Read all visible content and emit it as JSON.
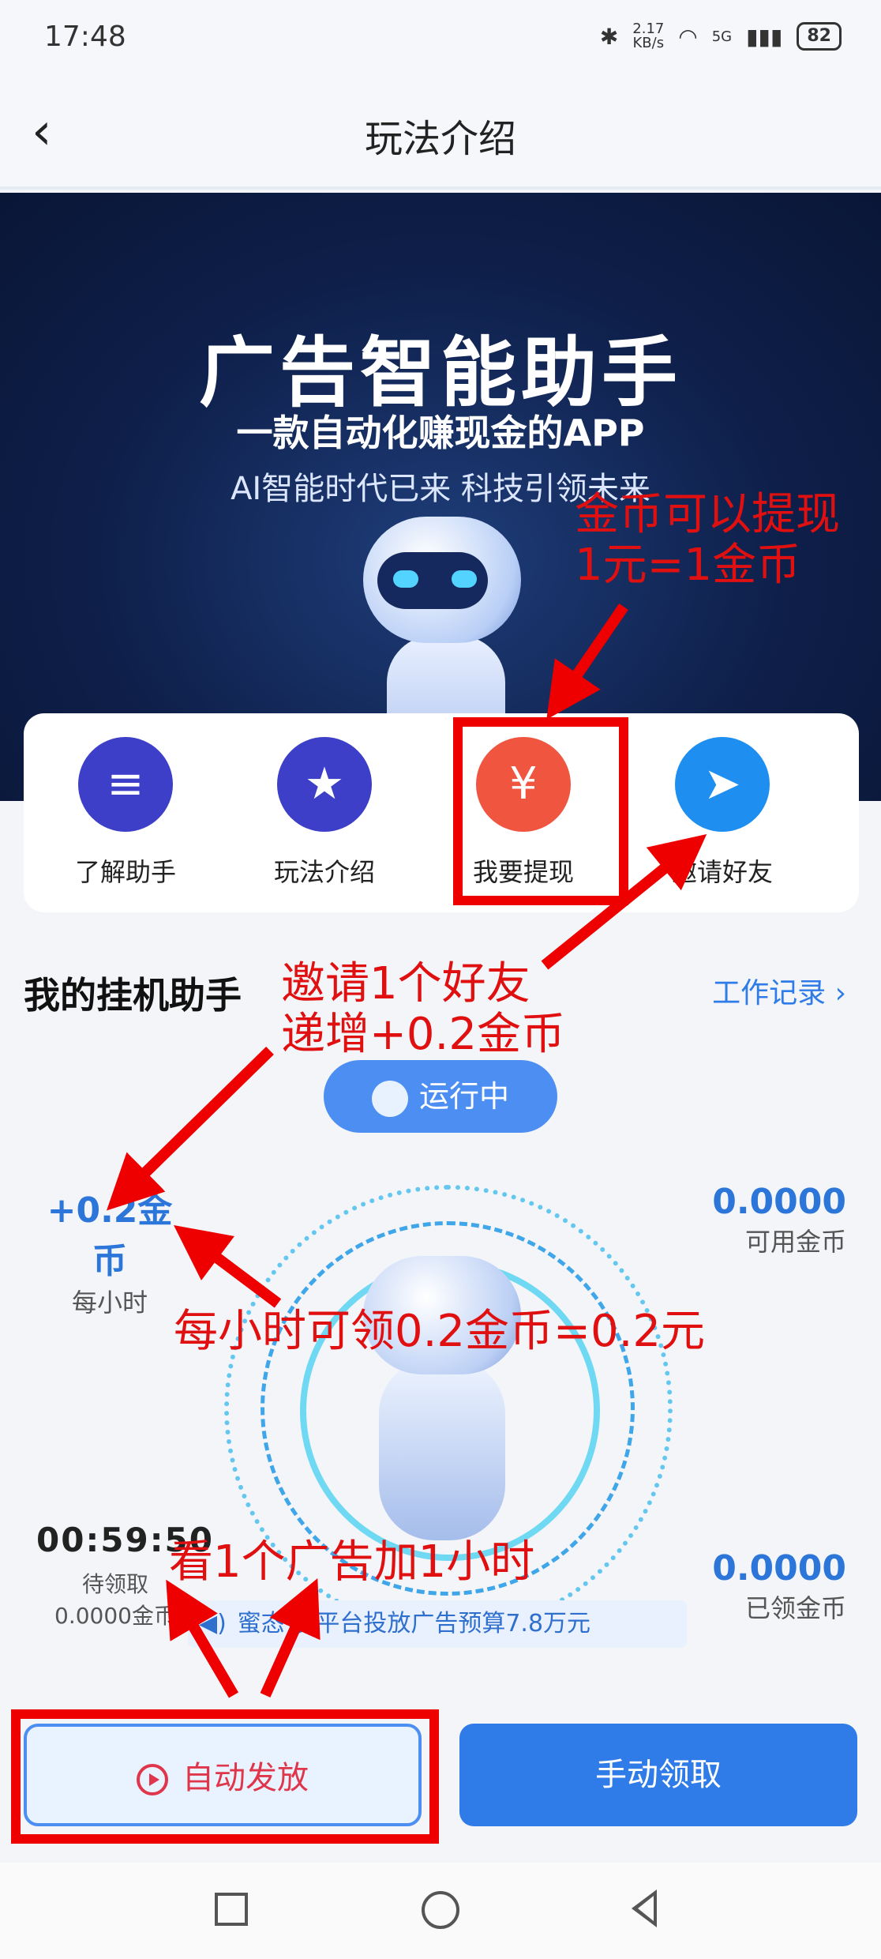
{
  "status": {
    "time": "17:48",
    "speed": "2.17 KB/s",
    "network": "5G",
    "battery": "82"
  },
  "header": {
    "title": "玩法介绍"
  },
  "banner": {
    "title": "广告智能助手",
    "subtitle": "一款自动化赚现金的APP",
    "tagline": "AI智能时代已来 科技引领未来"
  },
  "menu": {
    "items": [
      {
        "label": "了解助手",
        "color": "#3d3fc8"
      },
      {
        "label": "玩法介绍",
        "color": "#3d3fc8"
      },
      {
        "label": "我要提现",
        "color": "#f0553f"
      },
      {
        "label": "邀请好友",
        "color": "#1e8ff0"
      }
    ]
  },
  "section": {
    "title": "我的挂机助手",
    "record": "工作记录"
  },
  "running": "运行中",
  "stats": {
    "rate": "+0.2金币",
    "rate_unit": "每小时",
    "available": "0.0000",
    "available_label": "可用金币",
    "timer": "00:59:50",
    "pending_label": "待领取",
    "pending_value": "0.0000金币",
    "claimed": "0.0000",
    "claimed_label": "已领金币"
  },
  "ticker": "蜜态 友平台投放广告预算7.8万元",
  "buttons": {
    "auto": "自动发放",
    "manual": "手动领取"
  },
  "annotations": {
    "a1_line1": "金币可以提现",
    "a1_line2": "1元=1金币",
    "a2_line1": "邀请1个好友",
    "a2_line2": "递增+0.2金币",
    "a3": "每小时可领0.2金币=0.2元",
    "a4": "看1个广告加1小时"
  },
  "colors": {
    "accent": "#2f7be8",
    "annotation": "#e01010"
  }
}
